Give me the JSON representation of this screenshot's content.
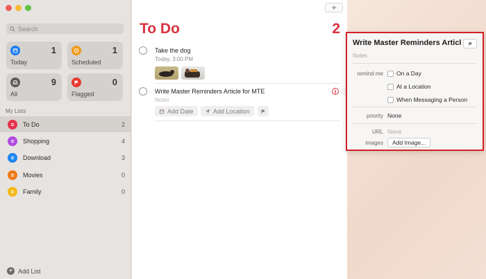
{
  "sidebar": {
    "search_placeholder": "Search",
    "smart_lists": [
      {
        "label": "Today",
        "count": "1",
        "color": "#1a7cf0"
      },
      {
        "label": "Scheduled",
        "count": "1",
        "color": "#f09a1a"
      },
      {
        "label": "All",
        "count": "9",
        "color": "#5b5a58"
      },
      {
        "label": "Flagged",
        "count": "0",
        "color": "#e8392f"
      }
    ],
    "my_lists_heading": "My Lists",
    "lists": [
      {
        "name": "To Do",
        "count": "2",
        "color": "#e5334a"
      },
      {
        "name": "Shopping",
        "count": "4",
        "color": "#b14be0"
      },
      {
        "name": "Download",
        "count": "3",
        "color": "#1e86f0"
      },
      {
        "name": "Movies",
        "count": "0",
        "color": "#f07a1a"
      },
      {
        "name": "Family",
        "count": "0",
        "color": "#f5b81a"
      }
    ],
    "add_list_label": "Add List"
  },
  "main": {
    "title": "To Do",
    "count": "2",
    "tasks": [
      {
        "title": "Take the dog",
        "subtitle": "Today, 3:00 PM"
      },
      {
        "title": "Write Master Reminders Article for MTE",
        "subtitle": "Notes"
      }
    ],
    "chips": {
      "add_date": "Add Date",
      "add_location": "Add Location"
    }
  },
  "popover": {
    "title": "Write Master Reminders Article for MTE",
    "notes_placeholder": "Notes",
    "remind_me_label": "remind me",
    "options": [
      "On a Day",
      "At a Location",
      "When Messaging a Person"
    ],
    "priority_label": "priority",
    "priority_value": "None",
    "url_label": "URL",
    "url_value": "None",
    "images_label": "images",
    "add_image_label": "Add Image..."
  },
  "colors": {
    "accent": "#d9323f",
    "highlight_border": "#d21f26"
  }
}
